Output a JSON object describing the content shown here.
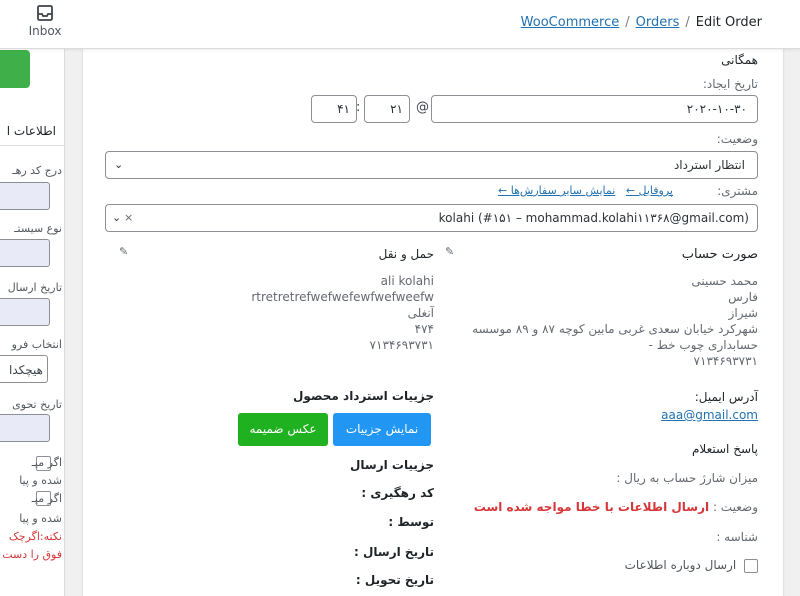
{
  "topbar": {
    "inbox_label": "Inbox",
    "breadcrumb": {
      "woocommerce": "WooCommerce",
      "orders": "Orders",
      "current": "Edit Order",
      "sep": "/"
    }
  },
  "sidebar": {
    "title": "اطلاعات ا",
    "labels": [
      "درج کد رهـ",
      "نوع سیستـ",
      "تاریخ ارسال",
      "انتخاب فرو",
      "تاریخ تحوی"
    ],
    "select_value": "هیچکدا",
    "checks": [
      {
        "line1": "اگر میـ",
        "line2": "شده و پیا"
      },
      {
        "line1": "اگر میـ",
        "line2": "شده و پیا"
      }
    ],
    "note1": "نکته:اگرچک",
    "note2": "فوق را دست"
  },
  "general": {
    "heading": "همگانی",
    "date_label": "تاریخ ایجاد:",
    "date_value": "۲۰۲۰-۱۰-۳۰",
    "at": "@",
    "hour": "۲۱",
    "minute": "۴۱",
    "colon": ":",
    "status_label": "وضعیت:",
    "status_value": "انتظار استرداد",
    "customer_label": "مشتری:",
    "profile_link": "پروفایل ←",
    "other_orders_link": "نمایش سایر سفارش‌ها ←",
    "customer_value": "kolahi (#۱۵۱ – mohammad.kolahi۱۱۳۶۸@gmail.com)",
    "clear": "×"
  },
  "billing": {
    "heading": "صورت حساب",
    "lines": [
      "محمد حسینی",
      "فارس",
      "شیراز",
      "شهرکرد خیابان سعدی غربی مابین کوچه ۸۷ و ۸۹ موسسه حسابداری چوب خط -",
      "۷۱۳۴۶۹۳۷۳۱"
    ],
    "email_label": "آدرس ایمیل:",
    "email_value": "aaa@gmail.com",
    "inquiry_heading": "پاسخ استعلام",
    "charge_label": "میزان شارژ حساب به ریال :",
    "status_label": "وضعیت :",
    "status_value": "ارسال اطلاعات با خطا مواجه شده است",
    "id_label": "شناسه :",
    "resend_label": "ارسال دوباره اطلاعات"
  },
  "shipping": {
    "heading": "حمل و نقل",
    "lines": [
      "ali kolahi",
      "rtretretrefwefwefewfwefweefw",
      "آنغلی",
      "۴۷۴",
      "۷۱۳۴۶۹۳۷۳۱"
    ],
    "refund_heading": "جزییات استرداد محصول",
    "show_details": "نمایش جزییات",
    "attachment": "عکس ضمیمه",
    "send_details": "جزییات ارسال",
    "tracking": "کد رهگیری :",
    "by": "توسط :",
    "send_date": "تاریخ ارسال :",
    "delivery_date": "تاریخ تحویل :"
  },
  "colors": {
    "link": "#2271b1",
    "blue_button": "#2196f3",
    "green_button": "#1fb11f",
    "error": "#d63638"
  }
}
